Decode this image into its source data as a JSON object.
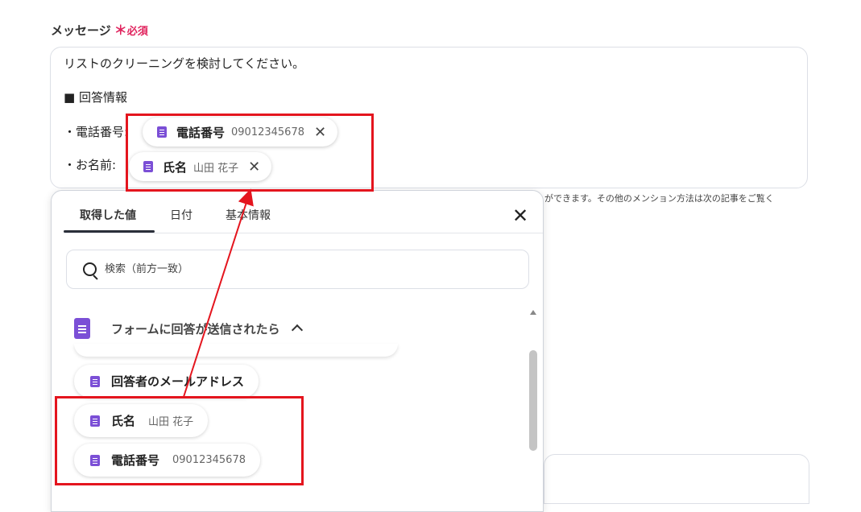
{
  "field": {
    "label": "メッセージ",
    "required_mark": "＊",
    "required_text": "必須"
  },
  "message": {
    "line1": "リストのクリーニングを検討してください。",
    "line2": "■ 回答情報",
    "phone_prefix": "・電話番号:",
    "name_prefix": "・お名前:"
  },
  "chips": {
    "phone": {
      "name": "電話番号",
      "value": "09012345678",
      "remove": "✕"
    },
    "name": {
      "name": "氏名",
      "value": "山田 花子",
      "remove": "✕"
    }
  },
  "helper_text": "ができます。その他のメンション方法は次の記事をご覧く",
  "popup": {
    "tabs": [
      "取得した値",
      "日付",
      "基本情報"
    ],
    "close": "✕",
    "search_placeholder": "検索（前方一致）",
    "group_title": "フォームに回答が送信されたら",
    "items": [
      {
        "name": "回答者のメールアドレス",
        "value": ""
      },
      {
        "name": "氏名",
        "value": "山田 花子"
      },
      {
        "name": "電話番号",
        "value": "09012345678"
      }
    ]
  },
  "colors": {
    "required": "#e0245e",
    "form_icon": "#7b4fd6",
    "highlight": "#e4151e",
    "tab_underline": "#2b2f3a"
  }
}
